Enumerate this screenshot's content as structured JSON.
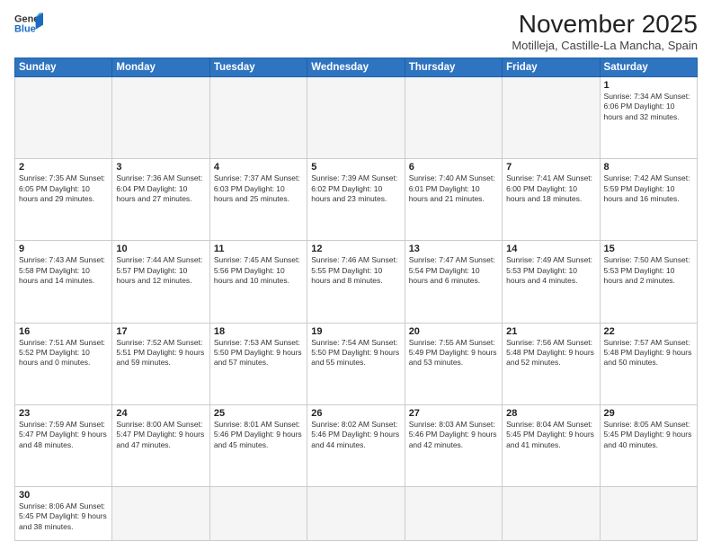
{
  "header": {
    "logo_general": "General",
    "logo_blue": "Blue",
    "title": "November 2025",
    "subtitle": "Motilleja, Castille-La Mancha, Spain"
  },
  "days_of_week": [
    "Sunday",
    "Monday",
    "Tuesday",
    "Wednesday",
    "Thursday",
    "Friday",
    "Saturday"
  ],
  "weeks": [
    [
      {
        "day": "",
        "info": ""
      },
      {
        "day": "",
        "info": ""
      },
      {
        "day": "",
        "info": ""
      },
      {
        "day": "",
        "info": ""
      },
      {
        "day": "",
        "info": ""
      },
      {
        "day": "",
        "info": ""
      },
      {
        "day": "1",
        "info": "Sunrise: 7:34 AM\nSunset: 6:06 PM\nDaylight: 10 hours\nand 32 minutes."
      }
    ],
    [
      {
        "day": "2",
        "info": "Sunrise: 7:35 AM\nSunset: 6:05 PM\nDaylight: 10 hours\nand 29 minutes."
      },
      {
        "day": "3",
        "info": "Sunrise: 7:36 AM\nSunset: 6:04 PM\nDaylight: 10 hours\nand 27 minutes."
      },
      {
        "day": "4",
        "info": "Sunrise: 7:37 AM\nSunset: 6:03 PM\nDaylight: 10 hours\nand 25 minutes."
      },
      {
        "day": "5",
        "info": "Sunrise: 7:39 AM\nSunset: 6:02 PM\nDaylight: 10 hours\nand 23 minutes."
      },
      {
        "day": "6",
        "info": "Sunrise: 7:40 AM\nSunset: 6:01 PM\nDaylight: 10 hours\nand 21 minutes."
      },
      {
        "day": "7",
        "info": "Sunrise: 7:41 AM\nSunset: 6:00 PM\nDaylight: 10 hours\nand 18 minutes."
      },
      {
        "day": "8",
        "info": "Sunrise: 7:42 AM\nSunset: 5:59 PM\nDaylight: 10 hours\nand 16 minutes."
      }
    ],
    [
      {
        "day": "9",
        "info": "Sunrise: 7:43 AM\nSunset: 5:58 PM\nDaylight: 10 hours\nand 14 minutes."
      },
      {
        "day": "10",
        "info": "Sunrise: 7:44 AM\nSunset: 5:57 PM\nDaylight: 10 hours\nand 12 minutes."
      },
      {
        "day": "11",
        "info": "Sunrise: 7:45 AM\nSunset: 5:56 PM\nDaylight: 10 hours\nand 10 minutes."
      },
      {
        "day": "12",
        "info": "Sunrise: 7:46 AM\nSunset: 5:55 PM\nDaylight: 10 hours\nand 8 minutes."
      },
      {
        "day": "13",
        "info": "Sunrise: 7:47 AM\nSunset: 5:54 PM\nDaylight: 10 hours\nand 6 minutes."
      },
      {
        "day": "14",
        "info": "Sunrise: 7:49 AM\nSunset: 5:53 PM\nDaylight: 10 hours\nand 4 minutes."
      },
      {
        "day": "15",
        "info": "Sunrise: 7:50 AM\nSunset: 5:53 PM\nDaylight: 10 hours\nand 2 minutes."
      }
    ],
    [
      {
        "day": "16",
        "info": "Sunrise: 7:51 AM\nSunset: 5:52 PM\nDaylight: 10 hours\nand 0 minutes."
      },
      {
        "day": "17",
        "info": "Sunrise: 7:52 AM\nSunset: 5:51 PM\nDaylight: 9 hours\nand 59 minutes."
      },
      {
        "day": "18",
        "info": "Sunrise: 7:53 AM\nSunset: 5:50 PM\nDaylight: 9 hours\nand 57 minutes."
      },
      {
        "day": "19",
        "info": "Sunrise: 7:54 AM\nSunset: 5:50 PM\nDaylight: 9 hours\nand 55 minutes."
      },
      {
        "day": "20",
        "info": "Sunrise: 7:55 AM\nSunset: 5:49 PM\nDaylight: 9 hours\nand 53 minutes."
      },
      {
        "day": "21",
        "info": "Sunrise: 7:56 AM\nSunset: 5:48 PM\nDaylight: 9 hours\nand 52 minutes."
      },
      {
        "day": "22",
        "info": "Sunrise: 7:57 AM\nSunset: 5:48 PM\nDaylight: 9 hours\nand 50 minutes."
      }
    ],
    [
      {
        "day": "23",
        "info": "Sunrise: 7:59 AM\nSunset: 5:47 PM\nDaylight: 9 hours\nand 48 minutes."
      },
      {
        "day": "24",
        "info": "Sunrise: 8:00 AM\nSunset: 5:47 PM\nDaylight: 9 hours\nand 47 minutes."
      },
      {
        "day": "25",
        "info": "Sunrise: 8:01 AM\nSunset: 5:46 PM\nDaylight: 9 hours\nand 45 minutes."
      },
      {
        "day": "26",
        "info": "Sunrise: 8:02 AM\nSunset: 5:46 PM\nDaylight: 9 hours\nand 44 minutes."
      },
      {
        "day": "27",
        "info": "Sunrise: 8:03 AM\nSunset: 5:46 PM\nDaylight: 9 hours\nand 42 minutes."
      },
      {
        "day": "28",
        "info": "Sunrise: 8:04 AM\nSunset: 5:45 PM\nDaylight: 9 hours\nand 41 minutes."
      },
      {
        "day": "29",
        "info": "Sunrise: 8:05 AM\nSunset: 5:45 PM\nDaylight: 9 hours\nand 40 minutes."
      }
    ],
    [
      {
        "day": "30",
        "info": "Sunrise: 8:06 AM\nSunset: 5:45 PM\nDaylight: 9 hours\nand 38 minutes."
      },
      {
        "day": "",
        "info": ""
      },
      {
        "day": "",
        "info": ""
      },
      {
        "day": "",
        "info": ""
      },
      {
        "day": "",
        "info": ""
      },
      {
        "day": "",
        "info": ""
      },
      {
        "day": "",
        "info": ""
      }
    ]
  ]
}
